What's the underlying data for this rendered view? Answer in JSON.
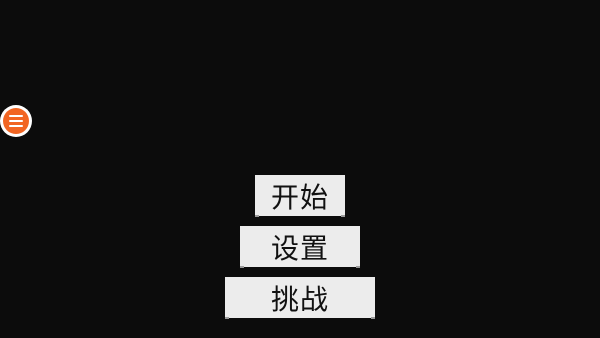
{
  "floating_menu": {
    "icon": "hamburger-menu-icon",
    "accent_color": "#f26522"
  },
  "main_menu": {
    "start_label": "开始",
    "settings_label": "设置",
    "challenge_label": "挑战"
  },
  "colors": {
    "background": "#0c0c0c",
    "button_bg": "#ececec",
    "button_text": "#111111"
  }
}
